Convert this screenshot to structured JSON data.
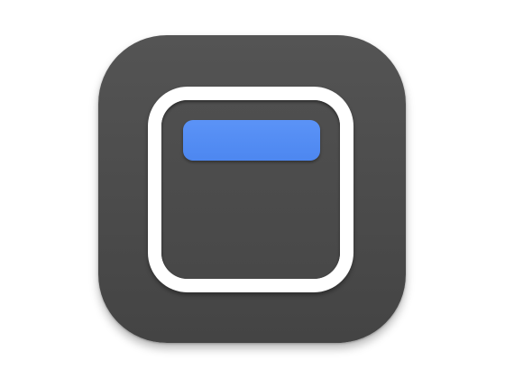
{
  "app_icon": {
    "icon": "window-titlebar-icon",
    "colors": {
      "background": "#4b4b4b",
      "frame": "#ffffff",
      "inner": "#4b4b4b",
      "title_bar": "#5590f5",
      "page": "#ffffff"
    }
  }
}
